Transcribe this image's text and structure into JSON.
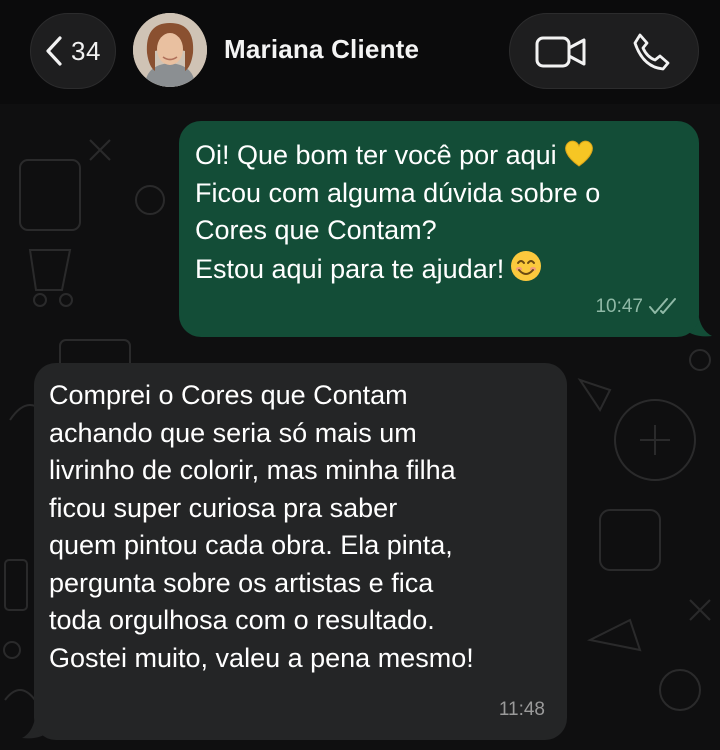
{
  "header": {
    "back_count": "34",
    "contact_name": "Mariana Cliente",
    "back_icon": "chevron-left-icon",
    "video_icon": "video-camera-icon",
    "phone_icon": "phone-icon"
  },
  "messages": [
    {
      "direction": "outgoing",
      "lines": [
        "Oi! Que bom ter você por aqui",
        "Ficou com alguma dúvida sobre o",
        "Cores que Contam?",
        "Estou aqui para te ajudar!"
      ],
      "time": "10:47",
      "status": "read",
      "emojis": [
        "yellow-heart-emoji",
        "smiling-face-emoji"
      ]
    },
    {
      "direction": "incoming",
      "lines": [
        "Comprei o Cores que Contam",
        "achando que seria só mais um",
        "livrinho de colorir, mas minha filha",
        "ficou super curiosa pra saber",
        "quem pintou cada obra. Ela pinta,",
        "pergunta sobre os artistas e fica",
        "toda orgulhosa com o resultado.",
        "Gostei muito, valeu a pena mesmo!"
      ],
      "time": "11:48"
    }
  ],
  "colors": {
    "outgoing_bubble": "#134d37",
    "incoming_bubble": "#242526",
    "background": "#0f0f10"
  }
}
